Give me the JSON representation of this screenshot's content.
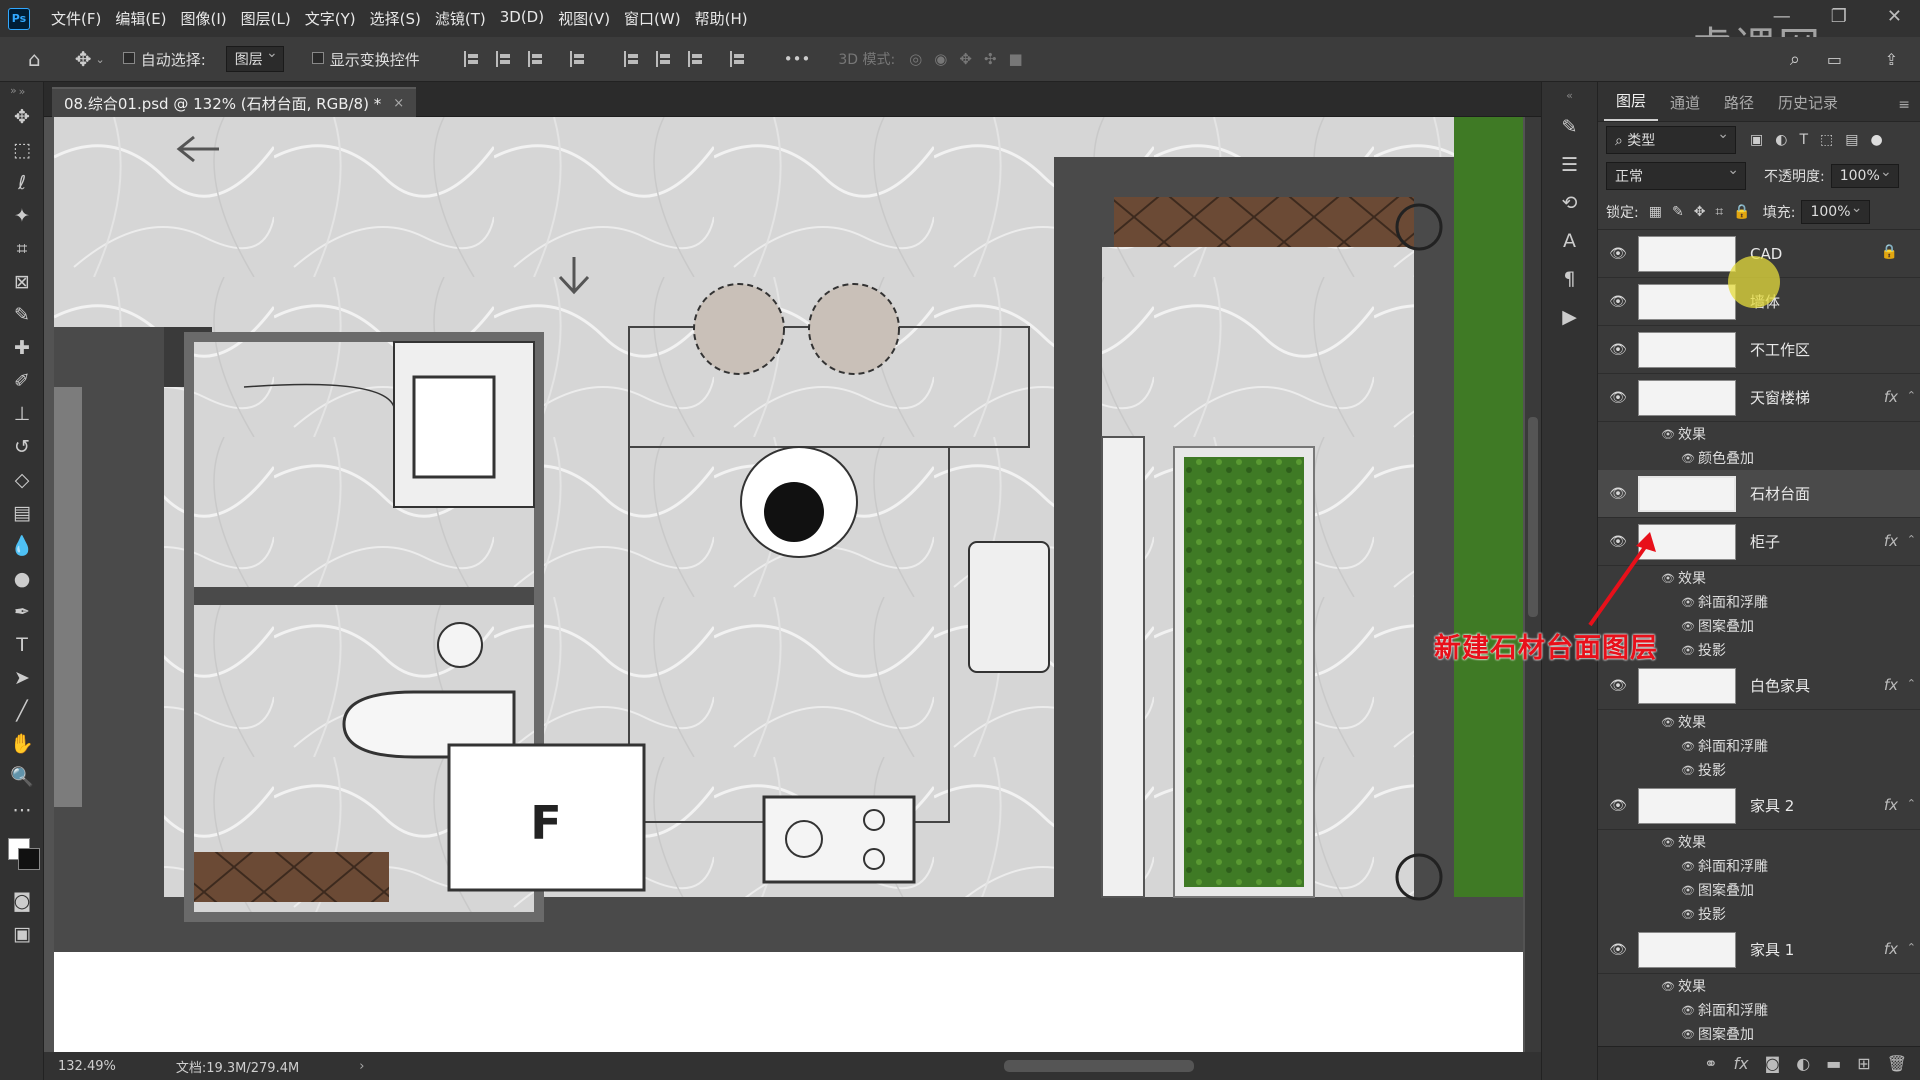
{
  "app": {
    "logo": "Ps"
  },
  "menu": [
    "文件(F)",
    "编辑(E)",
    "图像(I)",
    "图层(L)",
    "文字(Y)",
    "选择(S)",
    "滤镜(T)",
    "3D(D)",
    "视图(V)",
    "窗口(W)",
    "帮助(H)"
  ],
  "options": {
    "auto_select_label": "自动选择:",
    "auto_select_value": "图层",
    "show_transform_label": "显示变换控件",
    "mode3d_label": "3D 模式:",
    "more": "•••"
  },
  "document": {
    "tab_title": "08.综合01.psd @ 132% (石材台面, RGB/8) *",
    "close": "×"
  },
  "status": {
    "zoom": "132.49%",
    "doc_size": "文档:19.3M/279.4M",
    "arrow": "›"
  },
  "layers_panel": {
    "tabs": [
      "图层",
      "通道",
      "路径",
      "历史记录"
    ],
    "filter_label": "类型",
    "blend_mode": "正常",
    "opacity_label": "不透明度:",
    "opacity_value": "100%",
    "lock_label": "锁定:",
    "fill_label": "填充:",
    "fill_value": "100%",
    "effects_label": "效果",
    "layers": [
      {
        "name": "CAD",
        "locked": true,
        "fx": false,
        "effects": []
      },
      {
        "name": "墙体",
        "fx": false,
        "effects": []
      },
      {
        "name": "不工作区",
        "fx": false,
        "effects": []
      },
      {
        "name": "天窗楼梯",
        "fx": true,
        "effects": [
          "颜色叠加"
        ]
      },
      {
        "name": "石材台面",
        "fx": false,
        "selected": true,
        "effects": []
      },
      {
        "name": "柜子",
        "fx": true,
        "effects": [
          "斜面和浮雕",
          "图案叠加",
          "投影"
        ]
      },
      {
        "name": "白色家具",
        "fx": true,
        "effects": [
          "斜面和浮雕",
          "投影"
        ]
      },
      {
        "name": "家具 2",
        "fx": true,
        "effects": [
          "斜面和浮雕",
          "图案叠加",
          "投影"
        ]
      },
      {
        "name": "家具 1",
        "fx": true,
        "effects": [
          "斜面和浮雕",
          "图案叠加"
        ]
      }
    ]
  },
  "annotation": "新建石材台面图层",
  "watermark": "虎课网",
  "floorplan": {
    "fridge_label": "F"
  },
  "colors": {
    "accent_red": "#e8101a",
    "panel_bg": "#3a3a3a",
    "menubar_bg": "#323232"
  }
}
